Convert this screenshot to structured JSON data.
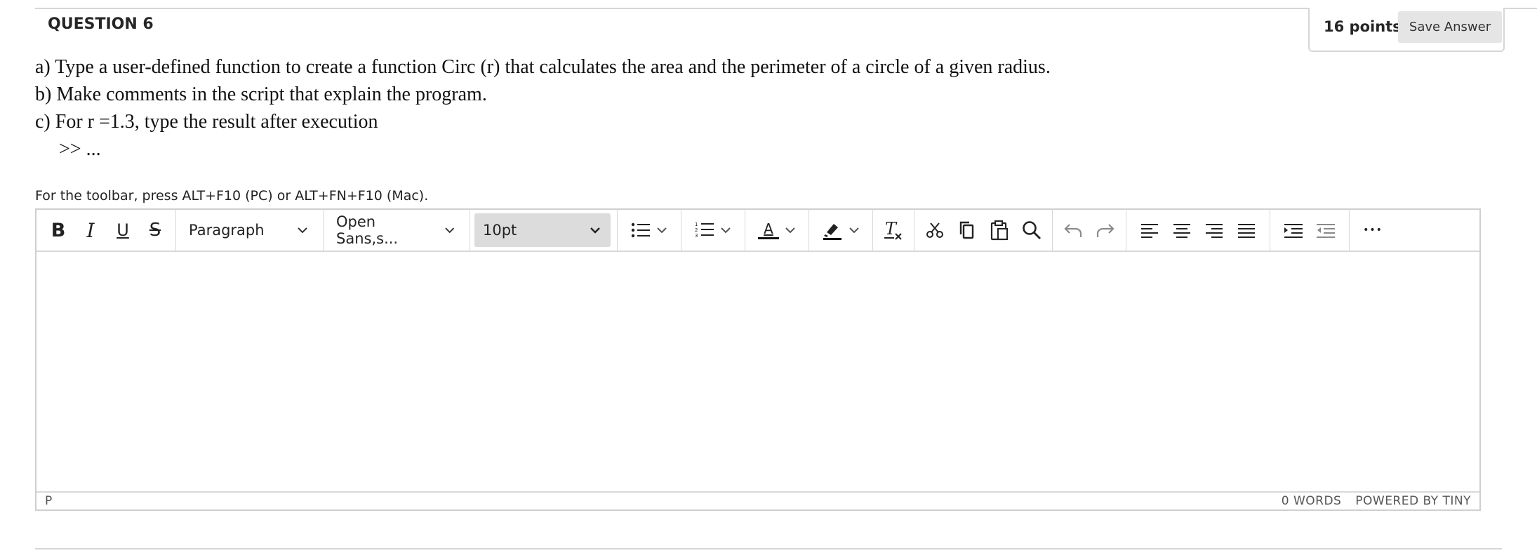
{
  "question": {
    "title": "QUESTION 6",
    "points": "16 points",
    "save_label": "Save Answer",
    "lines": [
      "a) Type a user-defined function to create a function Circ (r) that calculates the area and the perimeter of a circle of a given radius.",
      "b) Make comments in the script that explain the program.",
      "c) For r =1.3, type the result after execution",
      ">> ..."
    ]
  },
  "editor": {
    "toolbar_hint": "For the toolbar, press ALT+F10 (PC) or ALT+FN+F10 (Mac).",
    "block_format": "Paragraph",
    "font_family": "Open Sans,s...",
    "font_size": "10pt",
    "status_path": "P",
    "word_count": "0 WORDS",
    "powered_by": "POWERED BY TINY",
    "icons": {
      "bold": "B",
      "italic": "I",
      "underline": "U",
      "strikethrough": "S",
      "text_color": "A",
      "more": "•••"
    }
  }
}
